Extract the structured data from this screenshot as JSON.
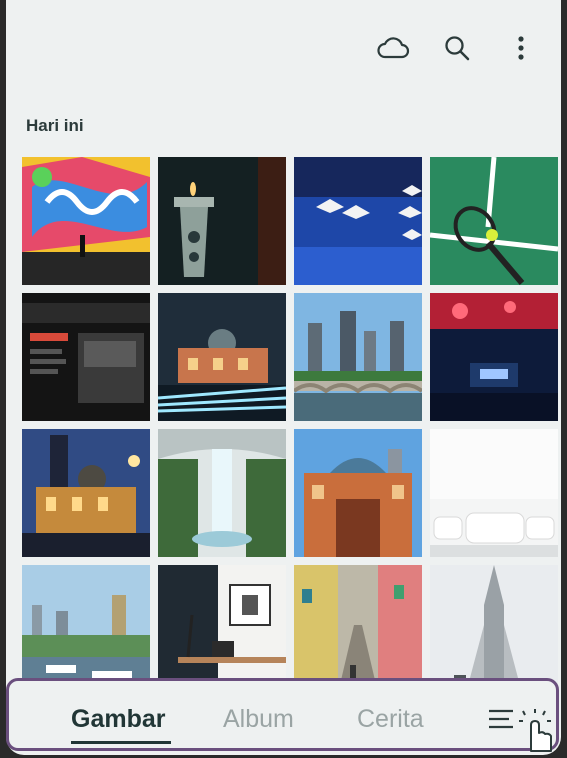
{
  "top_bar": {
    "icons": [
      "cloud-icon",
      "search-icon",
      "more-vert-icon"
    ]
  },
  "section": {
    "title": "Hari ini"
  },
  "photos": [
    {
      "subject": "graffiti-mural"
    },
    {
      "subject": "candle-lantern"
    },
    {
      "subject": "paper-boats"
    },
    {
      "subject": "tennis-racket"
    },
    {
      "subject": "laptop-screen"
    },
    {
      "subject": "flinders-station-night"
    },
    {
      "subject": "city-skyline-bridge"
    },
    {
      "subject": "concert-stage"
    },
    {
      "subject": "flinders-station-dusk"
    },
    {
      "subject": "indoor-waterfall"
    },
    {
      "subject": "flinders-station-day"
    },
    {
      "subject": "white-lounge"
    },
    {
      "subject": "harbor-city"
    },
    {
      "subject": "office-desk"
    },
    {
      "subject": "colorful-street"
    },
    {
      "subject": "church-tower"
    }
  ],
  "bottom_nav": {
    "tabs": [
      {
        "label": "Gambar",
        "active": true
      },
      {
        "label": "Album",
        "active": false
      },
      {
        "label": "Cerita",
        "active": false
      }
    ],
    "menu_icon": "menu-icon"
  },
  "colors": {
    "accent": "#213636",
    "inactive": "#9aa4a4",
    "border": "#6a4f7e",
    "background": "#eef1f1"
  }
}
